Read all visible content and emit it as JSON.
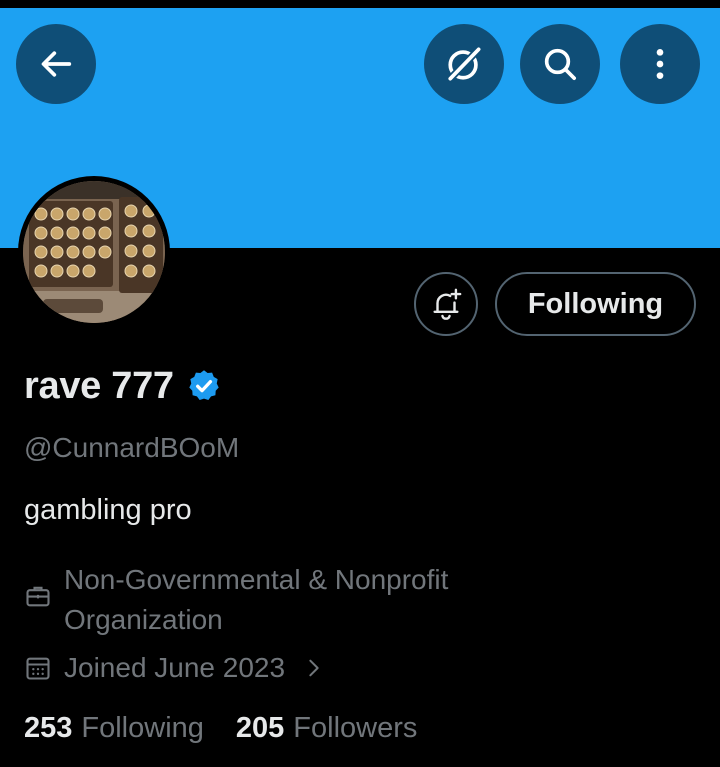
{
  "header": {
    "back_icon": "arrow-left-icon",
    "grok_icon": "grok-icon",
    "search_icon": "search-icon",
    "more_icon": "more-vertical-icon"
  },
  "colors": {
    "banner": "#1da1f2",
    "header_button": "#0f4e77",
    "verified": "#1d9bf0",
    "secondary_text": "#71767b",
    "primary_text": "#e7e9ea",
    "border": "#536471"
  },
  "actions": {
    "notify_icon": "bell-plus-icon",
    "following_label": "Following"
  },
  "profile": {
    "display_name": "rave 777",
    "verified_icon": "verified-badge-icon",
    "handle": "@CunnardBOoM",
    "bio": "gambling pro",
    "category": "Non-Governmental & Nonprofit Organization",
    "joined": "Joined June 2023",
    "following_count": "253",
    "following_label": "Following",
    "followers_count": "205",
    "followers_label": "Followers"
  }
}
